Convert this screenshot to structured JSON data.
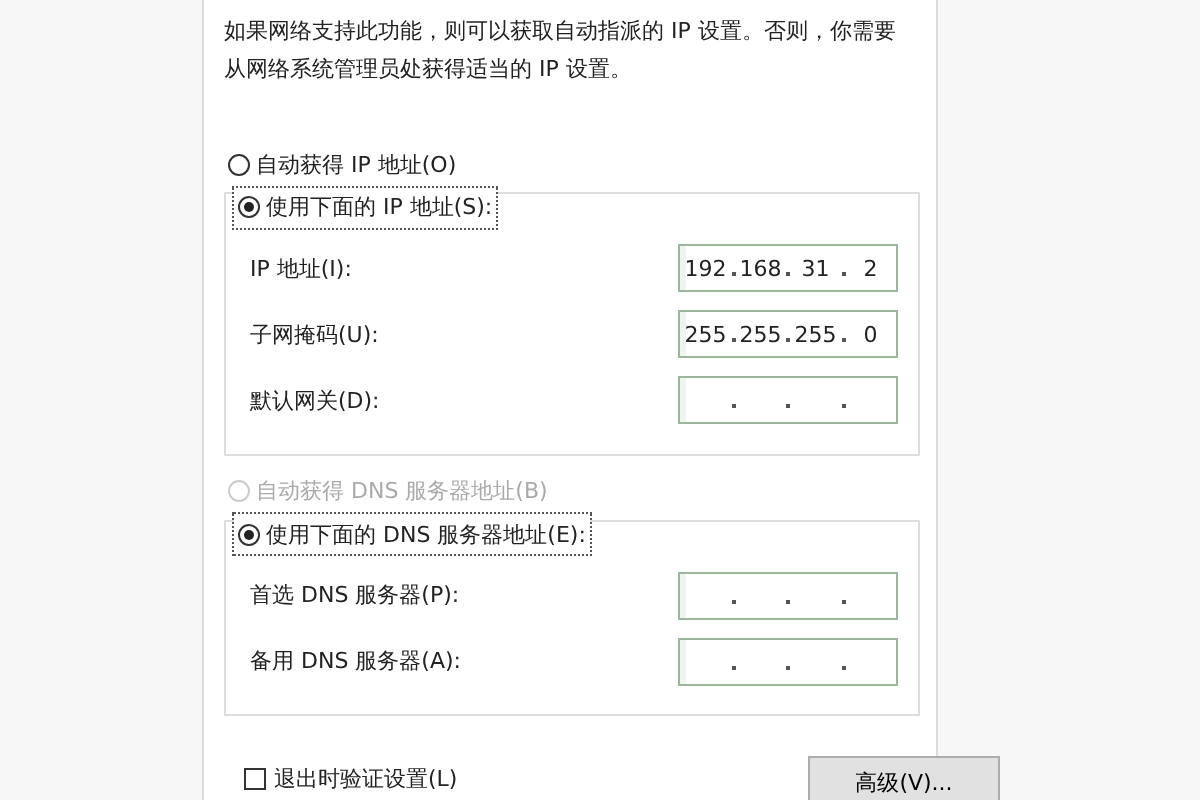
{
  "description": "如果网络支持此功能，则可以获取自动指派的 IP 设置。否则，你需要从网络系统管理员处获得适当的 IP 设置。",
  "ip_mode": [
    {
      "label": "自动获得 IP 地址(O)",
      "selected": false,
      "disabled": false
    },
    {
      "label": "使用下面的 IP 地址(S):",
      "selected": true,
      "disabled": false
    }
  ],
  "ip_fields": [
    {
      "label": "IP 地址(I):",
      "octets": [
        "192",
        "168",
        "31",
        "2"
      ]
    },
    {
      "label": "子网掩码(U):",
      "octets": [
        "255",
        "255",
        "255",
        "0"
      ]
    },
    {
      "label": "默认网关(D):"
    }
  ],
  "dns_mode": [
    {
      "label": "自动获得 DNS 服务器地址(B)",
      "selected": false,
      "disabled": true
    },
    {
      "label": "使用下面的 DNS 服务器地址(E):",
      "selected": true,
      "disabled": false
    }
  ],
  "dns_fields": [
    {
      "label": "首选 DNS 服务器(P):"
    },
    {
      "label": "备用 DNS 服务器(A):"
    }
  ],
  "validate_on_exit": {
    "label": "退出时验证设置(L)",
    "checked": false
  },
  "advanced_button": "高级(V)..."
}
